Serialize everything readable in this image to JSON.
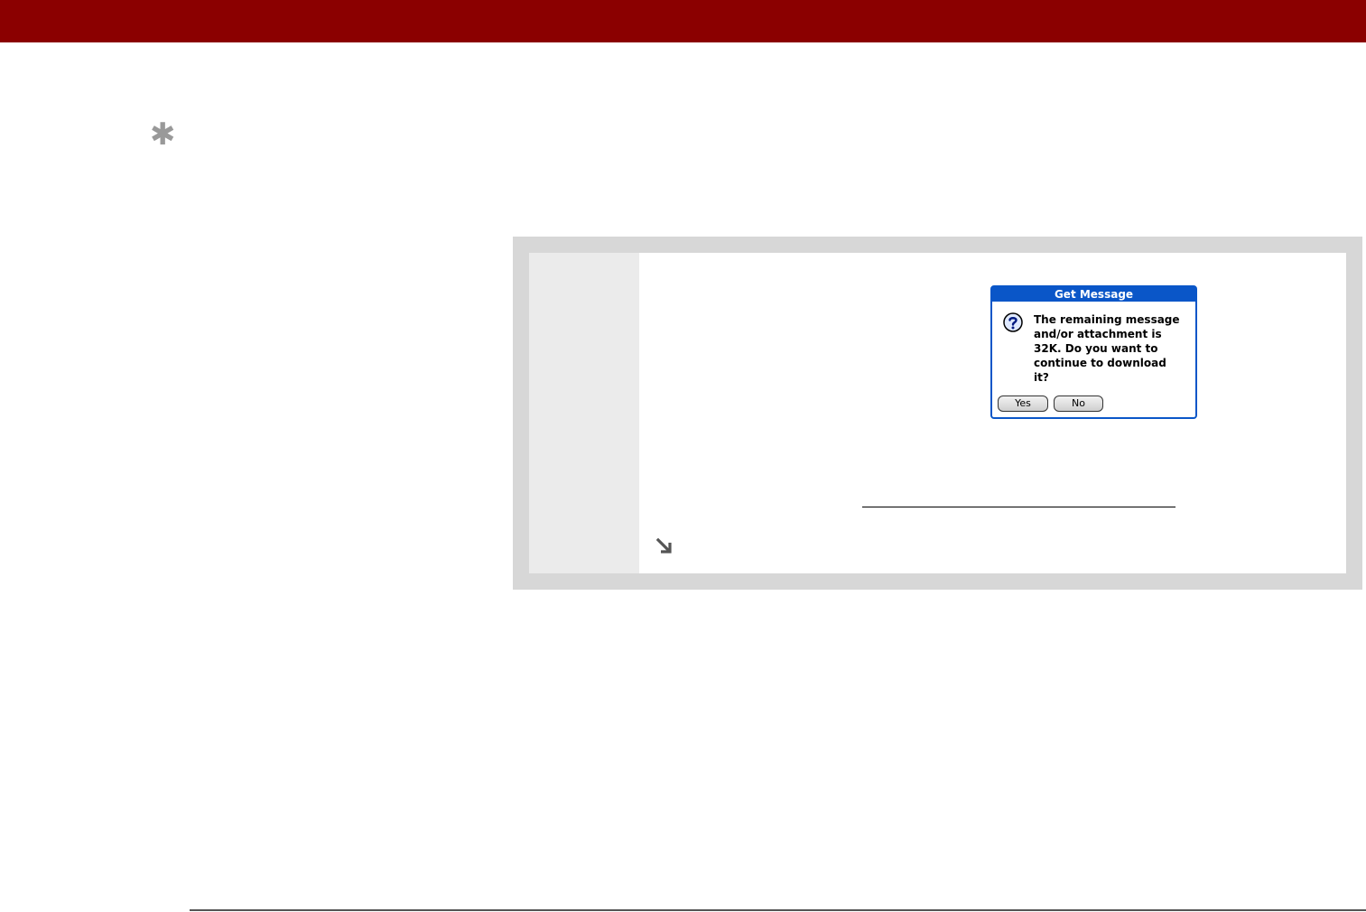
{
  "colors": {
    "header_bar": "#8b0000",
    "tip_icon": "#999999",
    "step_panel_border": "#d7d7d7",
    "step_gutter": "#ebebeb",
    "dialog_accent": "#0a56c8"
  },
  "tip": {
    "icon": "asterisk-icon",
    "glyph": "✱"
  },
  "dialog": {
    "title": "Get Message",
    "icon": "question-icon",
    "message": "The remaining message\nand/or attachment is\n32K. Do you want to\ncontinue to download\nit?",
    "yes_label": "Yes",
    "no_label": "No"
  },
  "step": {
    "continue_icon": "arrow-down-right-icon"
  }
}
